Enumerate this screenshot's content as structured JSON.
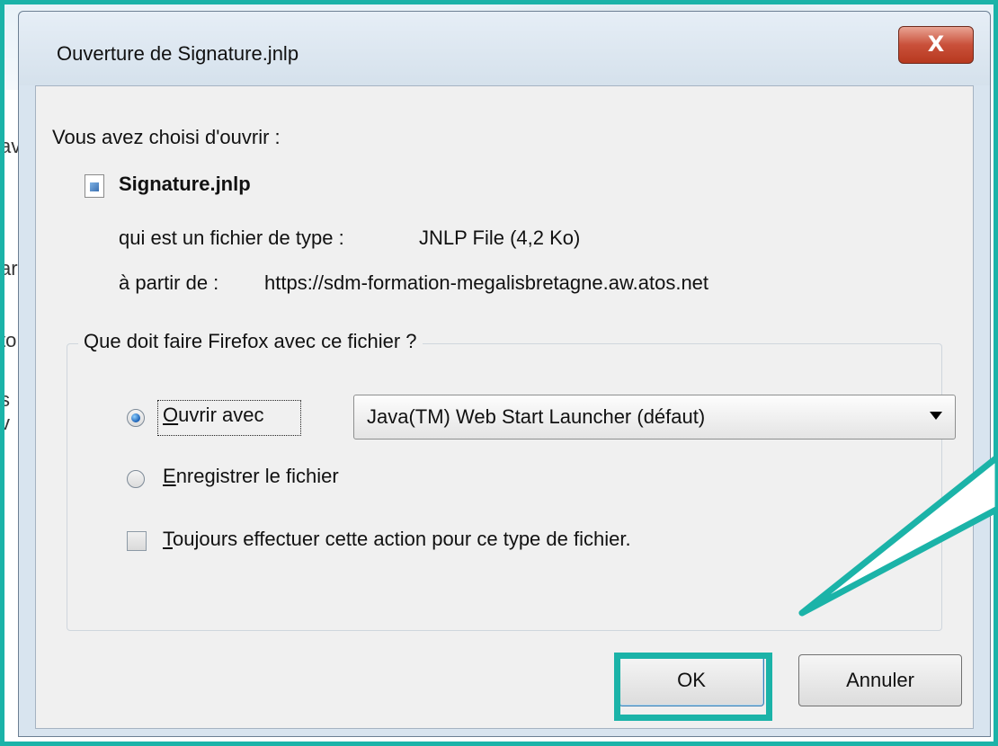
{
  "background": {
    "fragments": [
      "av",
      "ar",
      "to",
      "s v"
    ]
  },
  "dialog": {
    "title": "Ouverture de Signature.jnlp",
    "close_glyph": "X",
    "intro": "Vous avez choisi d'ouvrir :",
    "file_name": "Signature.jnlp",
    "type_label": "qui est un fichier de type :",
    "type_value": "JNLP File (4,2 Ko)",
    "from_label": "à partir de :",
    "from_value": "https://sdm-formation-megalisbretagne.aw.atos.net",
    "group_title": "Que doit faire Firefox avec ce fichier ?",
    "open_with": {
      "accesskey": "O",
      "label_rest": "uvrir avec",
      "selected": true,
      "app": "Java(TM) Web Start Launcher (défaut)"
    },
    "save_file": {
      "accesskey": "E",
      "label_rest": "nregistrer le fichier",
      "selected": false
    },
    "always": {
      "accesskey": "T",
      "label_rest": "oujours effectuer cette action pour ce type de fichier.",
      "checked": false
    },
    "ok_label": "OK",
    "cancel_label": "Annuler"
  },
  "colors": {
    "annotation": "#1bb3a8"
  }
}
